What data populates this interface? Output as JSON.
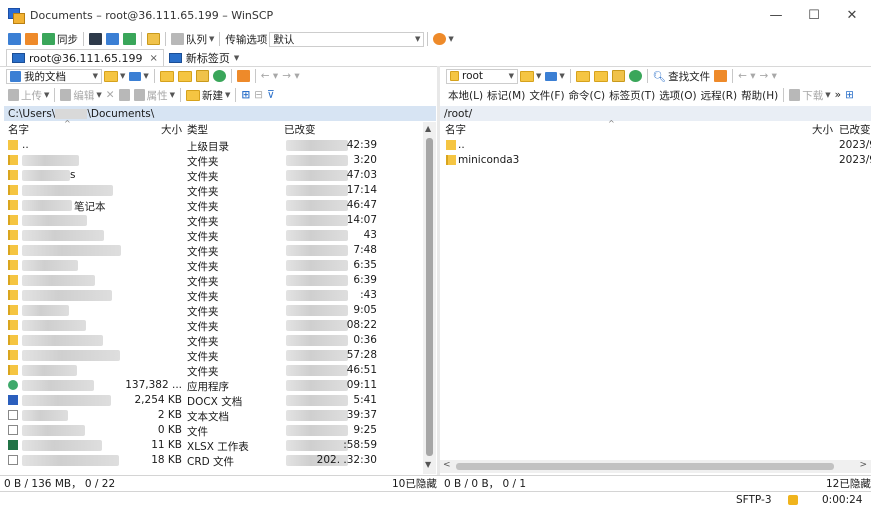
{
  "window": {
    "title": "Documents – root@36.111.65.199 – WinSCP",
    "controls": [
      "—",
      "☐",
      "✕"
    ]
  },
  "toolbar": {
    "sync_label": "同步",
    "queue_label": "队列",
    "transfer_options_label": "传输选项",
    "transfer_default": "默认"
  },
  "tabs": [
    {
      "label": "root@36.111.65.199",
      "close": "×"
    },
    {
      "label": "新标签页"
    }
  ],
  "left": {
    "location_combo": "我的文档",
    "upload_label": "上传",
    "edit_label": "编辑",
    "props_label": "属性",
    "new_label": "新建",
    "path_prefix": "C:\\Users\\",
    "path_suffix": "\\Documents\\",
    "headers": {
      "name": "名字",
      "size": "大小",
      "type": "类型",
      "changed": "已改变"
    },
    "rows": [
      {
        "icon": "up",
        "name": "..",
        "size": "",
        "type": "上级目录",
        "changed": "42:39"
      },
      {
        "icon": "folder",
        "name": "",
        "size": "",
        "type": "文件夹",
        "changed": "3:20"
      },
      {
        "icon": "folder",
        "name": "s",
        "size": "",
        "type": "文件夹",
        "changed": "47:03"
      },
      {
        "icon": "folder",
        "name": "",
        "size": "",
        "type": "文件夹",
        "changed": "17:14"
      },
      {
        "icon": "folder",
        "name": "笔记本",
        "size": "",
        "type": "文件夹",
        "changed": "46:47"
      },
      {
        "icon": "folder",
        "name": "",
        "size": "",
        "type": "文件夹",
        "changed": "14:07"
      },
      {
        "icon": "folder",
        "name": "",
        "size": "",
        "type": "文件夹",
        "changed": "43"
      },
      {
        "icon": "folder",
        "name": "",
        "size": "",
        "type": "文件夹",
        "changed": "7:48"
      },
      {
        "icon": "folder",
        "name": "",
        "size": "",
        "type": "文件夹",
        "changed": "6:35"
      },
      {
        "icon": "folder",
        "name": "",
        "size": "",
        "type": "文件夹",
        "changed": "6:39"
      },
      {
        "icon": "folder",
        "name": "",
        "size": "",
        "type": "文件夹",
        "changed": ":43"
      },
      {
        "icon": "folder",
        "name": "",
        "size": "",
        "type": "文件夹",
        "changed": "9:05"
      },
      {
        "icon": "folder",
        "name": "",
        "size": "",
        "type": "文件夹",
        "changed": "08:22"
      },
      {
        "icon": "folder",
        "name": "",
        "size": "",
        "type": "文件夹",
        "changed": "0:36"
      },
      {
        "icon": "folder",
        "name": "",
        "size": "",
        "type": "文件夹",
        "changed": "57:28"
      },
      {
        "icon": "folder",
        "name": "",
        "size": "",
        "type": "文件夹",
        "changed": "46:51"
      },
      {
        "icon": "app",
        "name": "",
        "size": "137,382 ...",
        "type": "应用程序",
        "changed": "09:11"
      },
      {
        "icon": "docx",
        "name": "",
        "size": "2,254 KB",
        "type": "DOCX 文档",
        "changed": "5:41"
      },
      {
        "icon": "txt",
        "name": "",
        "size": "2 KB",
        "type": "文本文档",
        "changed": "39:37"
      },
      {
        "icon": "file",
        "name": "",
        "size": "0 KB",
        "type": "文件",
        "changed": "9:25"
      },
      {
        "icon": "xlsx",
        "name": "",
        "size": "11 KB",
        "type": "XLSX 工作表",
        "changed": ":58:59"
      },
      {
        "icon": "crd",
        "name": "",
        "size": "18 KB",
        "type": "CRD 文件",
        "changed": "202.   .32:30"
      }
    ],
    "status": "0 B / 136 MB， 0 / 22",
    "hidden": "10已隐藏"
  },
  "right": {
    "location_combo": "root",
    "find_label": "查找文件",
    "menu": [
      "本地(L)",
      "标记(M)",
      "文件(F)",
      "命令(C)",
      "标签页(T)",
      "选项(O)",
      "远程(R)",
      "帮助(H)"
    ],
    "download_label": "下载",
    "path": "/root/",
    "headers": {
      "name": "名字",
      "size": "大小",
      "changed": "已改变"
    },
    "rows": [
      {
        "icon": "up",
        "name": "..",
        "changed": "2023/9"
      },
      {
        "icon": "folder",
        "name": "miniconda3",
        "changed": "2023/9"
      }
    ],
    "status": "0 B / 0 B， 0 / 1",
    "hidden": "12已隐藏"
  },
  "footer": {
    "protocol": "SFTP-3",
    "time": "0:00:24"
  }
}
